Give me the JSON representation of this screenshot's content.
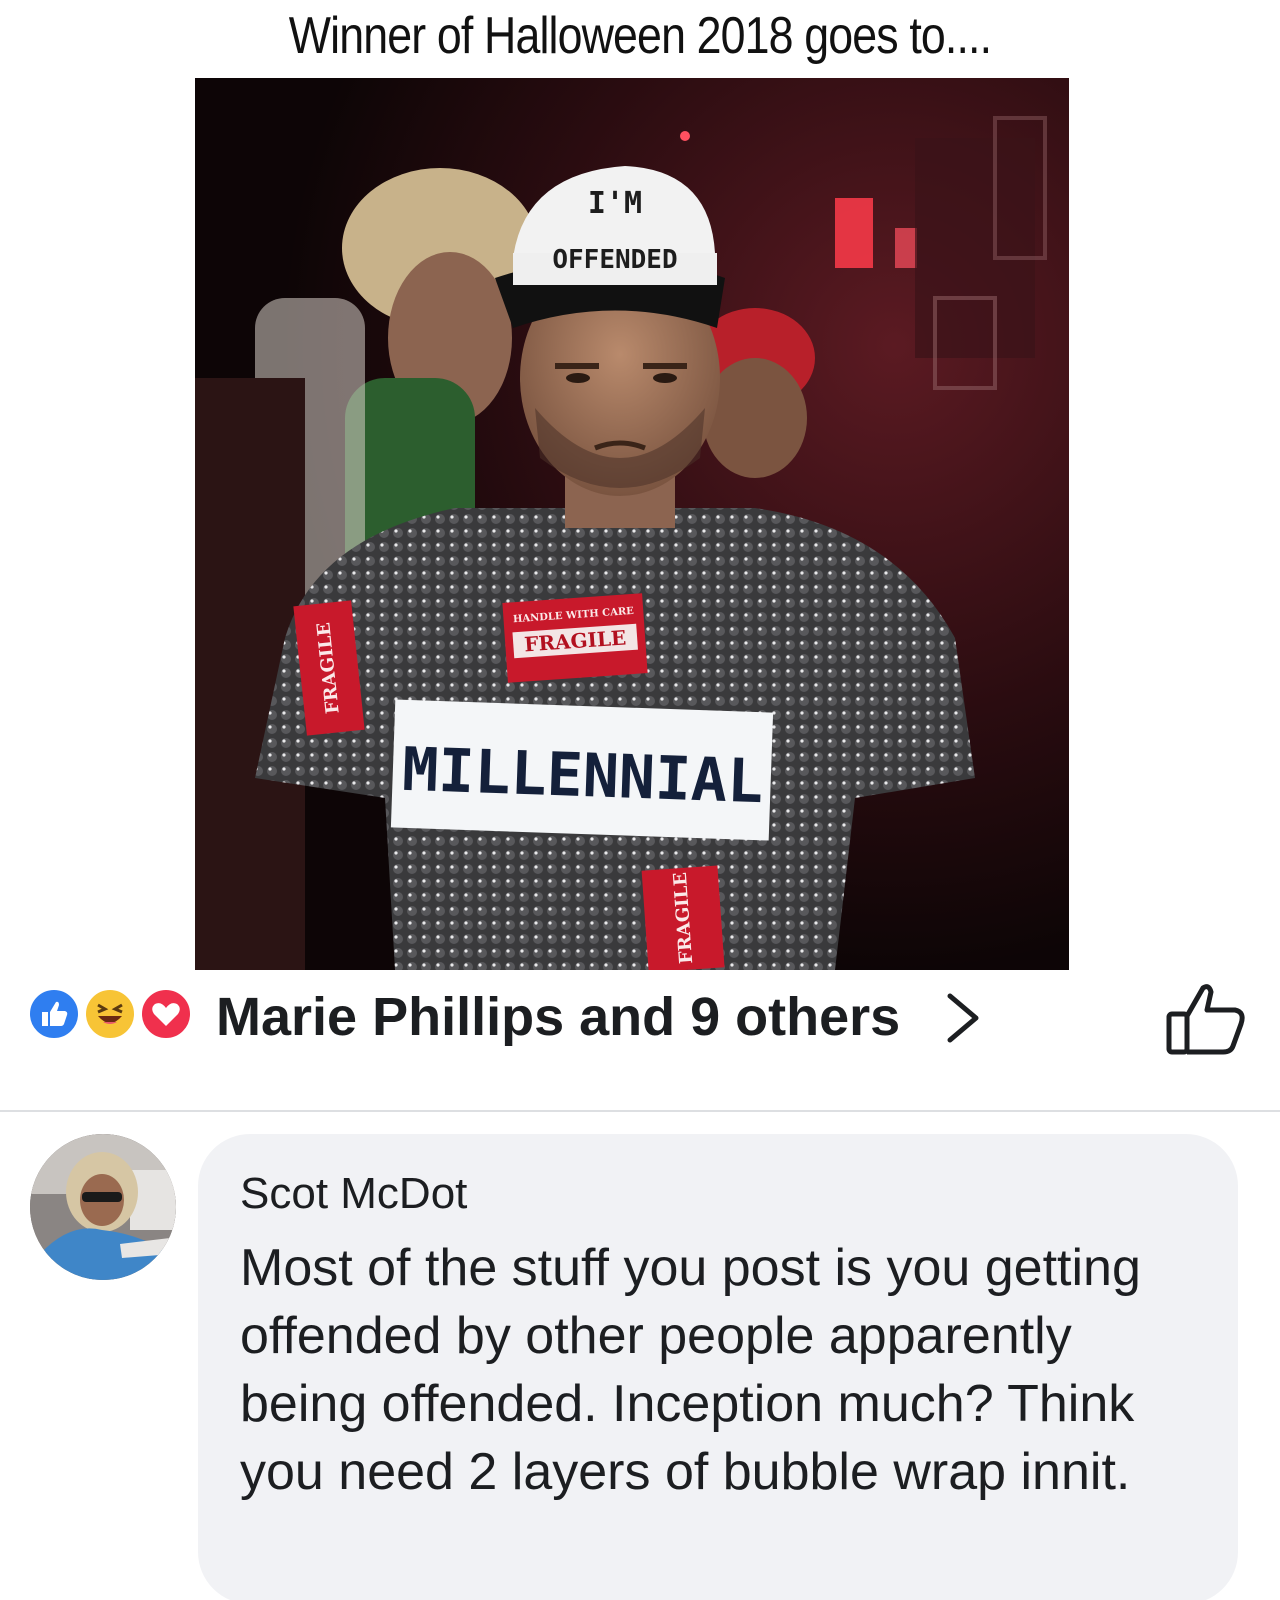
{
  "post": {
    "title": "Winner of Halloween 2018 goes to....",
    "image_text": {
      "hat_line1": "I'M",
      "hat_line2": "OFFENDED",
      "sign": "MILLENNIAL",
      "label_center": "FRAGILE",
      "label_left": "FRAGILE",
      "label_bottom": "FRAGILE",
      "label_small": "HANDLE WITH CARE"
    }
  },
  "reactions": {
    "icons": [
      "like-icon",
      "haha-icon",
      "love-icon"
    ],
    "summary": "Marie Phillips and 9 others",
    "colors": {
      "like": "#2f7ef0",
      "haha": "#f7c436",
      "love": "#f0304d"
    }
  },
  "comment": {
    "author": "Scot McDot",
    "text": "Most of the stuff you post is you getting offended by other people apparently being offended. Inception much? Think you need 2 layers of bubble wrap innit."
  }
}
